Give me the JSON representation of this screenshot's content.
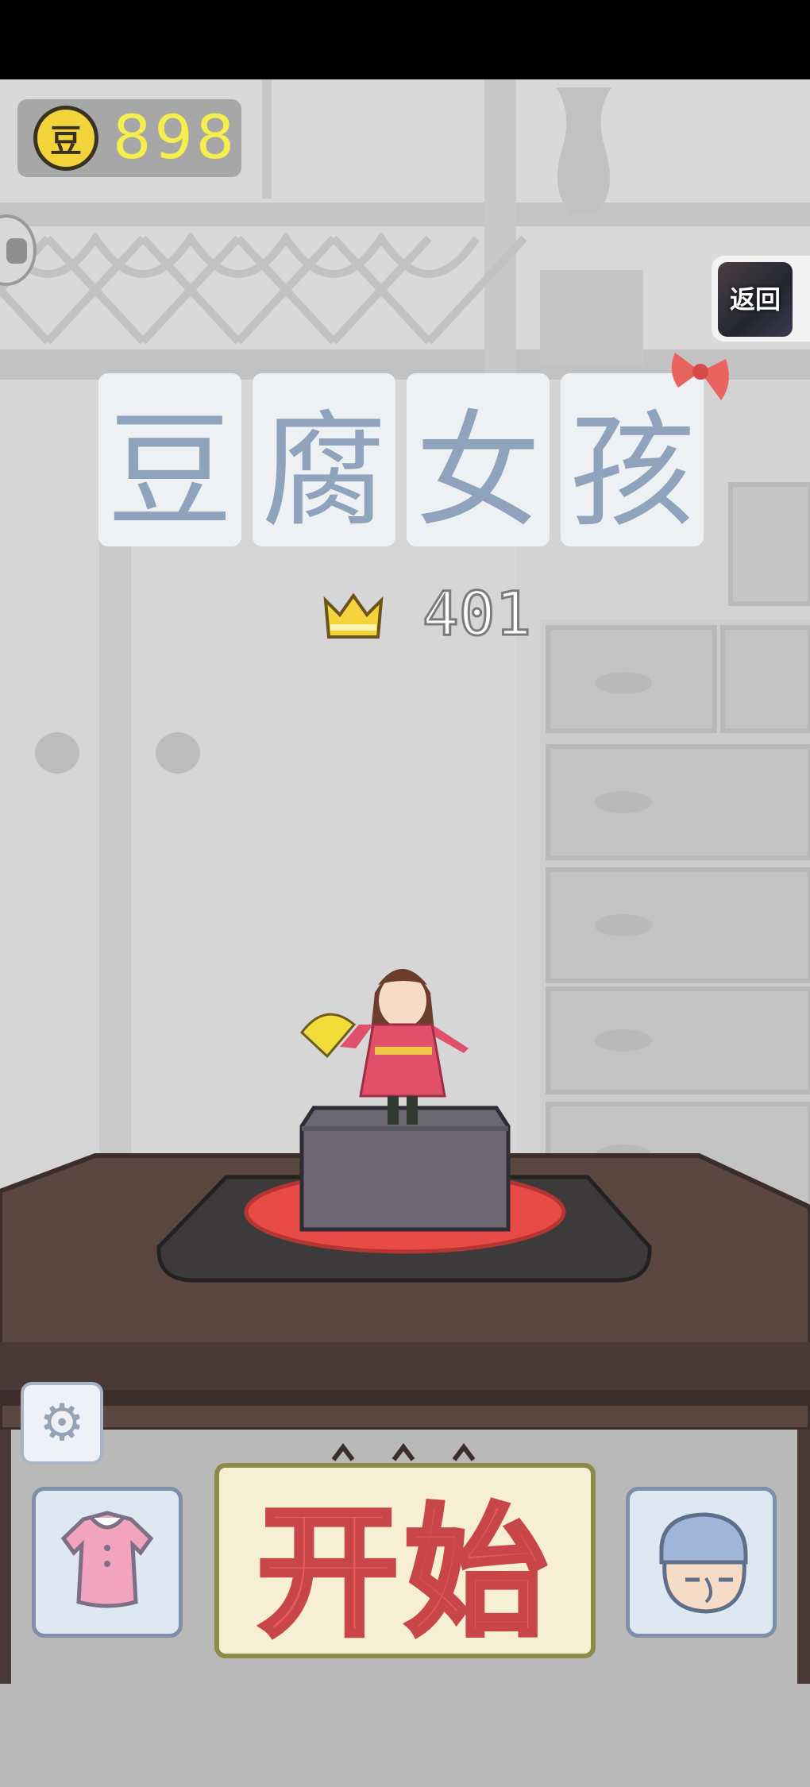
{
  "coins": {
    "icon_char": "豆",
    "count": "898"
  },
  "back_button": {
    "label": "返回"
  },
  "title": {
    "chars": [
      "豆",
      "腐",
      "女",
      "孩"
    ]
  },
  "best_score": {
    "value": "401"
  },
  "start_button": {
    "label": "开始"
  },
  "colors": {
    "coin_text": "#f6ee4c",
    "title_char": "#8fa3bd",
    "start_text": "#ea5a5e",
    "tofu": "#6b6873",
    "plate": "#e84a46",
    "table": "#5a4740"
  },
  "icons": {
    "settings": "gear-icon",
    "wardrobe": "dress-icon",
    "character": "old-man-face-icon",
    "best": "crown-icon"
  }
}
